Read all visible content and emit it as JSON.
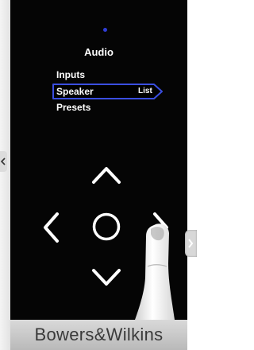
{
  "screen": {
    "title": "Audio"
  },
  "menu": {
    "items": [
      {
        "label": "Inputs"
      },
      {
        "label": "Speaker",
        "value": "List",
        "selected": true
      },
      {
        "label": "Presets"
      }
    ]
  },
  "controls": [
    "up-arrow-icon",
    "left-arrow-icon",
    "center-circle-icon",
    "right-arrow-icon",
    "down-arrow-icon"
  ],
  "footer": {
    "brand": "Bowers&Wilkins"
  },
  "colors": {
    "accent": "#2f3dd6",
    "screen": "#050505",
    "footer": "#c8c8c8"
  }
}
